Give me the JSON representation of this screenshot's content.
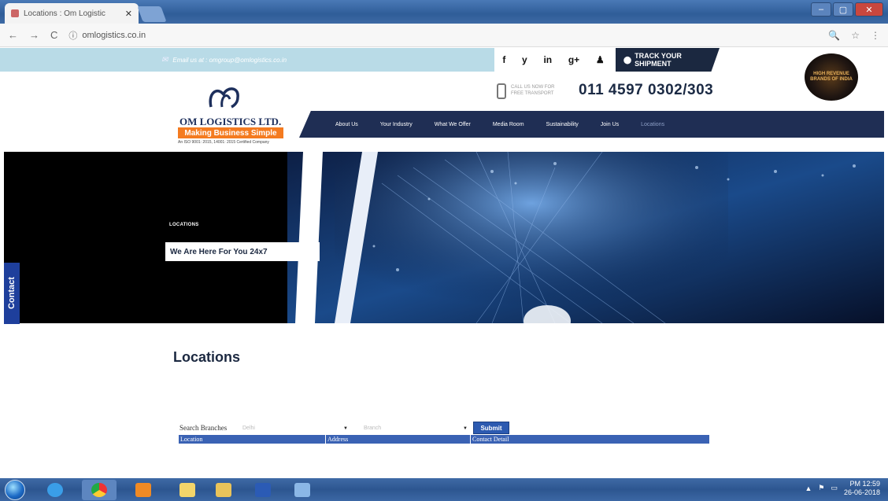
{
  "browser": {
    "tab_title": "Locations : Om Logistic",
    "tab_close": "✕",
    "url": "omlogistics.co.in",
    "nav_back": "←",
    "nav_forward": "→",
    "nav_reload": "C",
    "info_icon": "ⓘ",
    "zoom_icon": "🔍",
    "star_icon": "☆",
    "menu_icon": "⋮",
    "win_min": "–",
    "win_max": "▢",
    "win_close": "✕"
  },
  "site": {
    "email_text": "Email us at : omgroup@omlogistics.co.in",
    "social": [
      "f",
      "y",
      "in",
      "g+",
      "♟"
    ],
    "track_label": "TRACK YOUR SHIPMENT",
    "call_label_1": "CALL US NOW FOR",
    "call_label_2": "FREE TRANSPORT",
    "phone": "011 4597 0302/303",
    "badge_text": "HIGH REVENUE BRANDS OF INDIA",
    "logo_name": "OM LOGISTICS LTD.",
    "logo_tagline": "Making Business Simple",
    "logo_cert": "An ISO 9001: 2015, 14001: 2015 Certified Company",
    "nav": [
      {
        "label": "About Us"
      },
      {
        "label": "Your Industry"
      },
      {
        "label": "What We Offer"
      },
      {
        "label": "Media Room"
      },
      {
        "label": "Sustainability"
      },
      {
        "label": "Join Us"
      },
      {
        "label": "Locations"
      }
    ],
    "hero_label": "LOCATIONS",
    "hero_heading": "We Are Here For You 24x7",
    "contact_tab": "Contact",
    "page_heading": "Locations",
    "search_label": "Search Branches",
    "select1_value": "Delhi",
    "select2_value": "Branch",
    "submit_label": "Submit",
    "table_headers": [
      "Location",
      "Address",
      "Contact Detail"
    ]
  },
  "taskbar": {
    "time": "PM 12:59",
    "date": "26-06-2018"
  },
  "colors": {
    "navy": "#1f2e54",
    "orange": "#f47b20",
    "blue_accent": "#2c5ab0"
  }
}
